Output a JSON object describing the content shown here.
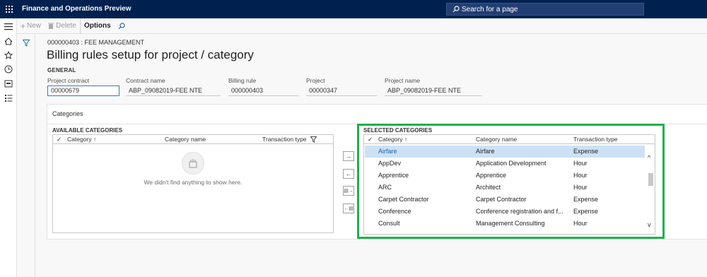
{
  "app": {
    "title": "Finance and Operations Preview"
  },
  "search": {
    "label": "Search for a page"
  },
  "actions": {
    "new": "New",
    "delete": "Delete",
    "options": "Options"
  },
  "breadcrumb": "000000403 : FEE MANAGEMENT",
  "page_title": "Billing rules setup for project / category",
  "general": {
    "heading": "GENERAL",
    "fields": [
      {
        "label": "Project contract",
        "value": "00000679"
      },
      {
        "label": "Contract name",
        "value": "ABP_09082019-FEE NTE"
      },
      {
        "label": "Billing rule",
        "value": "000000403"
      },
      {
        "label": "Project",
        "value": "00000347"
      },
      {
        "label": "Project name",
        "value": "ABP_09082019-FEE NTE"
      }
    ]
  },
  "categories": {
    "title": "Categories",
    "available": {
      "title": "AVAILABLE CATEGORIES",
      "columns": [
        "Category",
        "Category name",
        "Transaction type"
      ],
      "empty_message": "We didn't find anything to show here."
    },
    "selected": {
      "title": "SELECTED CATEGORIES",
      "columns": [
        "Category",
        "Category name",
        "Transaction type"
      ],
      "rows": [
        {
          "category": "Airfare",
          "name": "Airfare",
          "type": "Expense",
          "selected": true
        },
        {
          "category": "AppDev",
          "name": "Application Development",
          "type": "Hour"
        },
        {
          "category": "Apprentice",
          "name": "Apprentice",
          "type": "Hour"
        },
        {
          "category": "ARC",
          "name": "Architect",
          "type": "Hour"
        },
        {
          "category": "Carpet Contractor",
          "name": "Carpet Contractor",
          "type": "Expense"
        },
        {
          "category": "Conference",
          "name": "Conference registration and f...",
          "type": "Expense"
        },
        {
          "category": "Consult",
          "name": "Management Consulting",
          "type": "Hour"
        }
      ]
    }
  },
  "colors": {
    "topbar": "#002050",
    "highlight": "#20b04a",
    "selected_row": "#cce1f6"
  }
}
